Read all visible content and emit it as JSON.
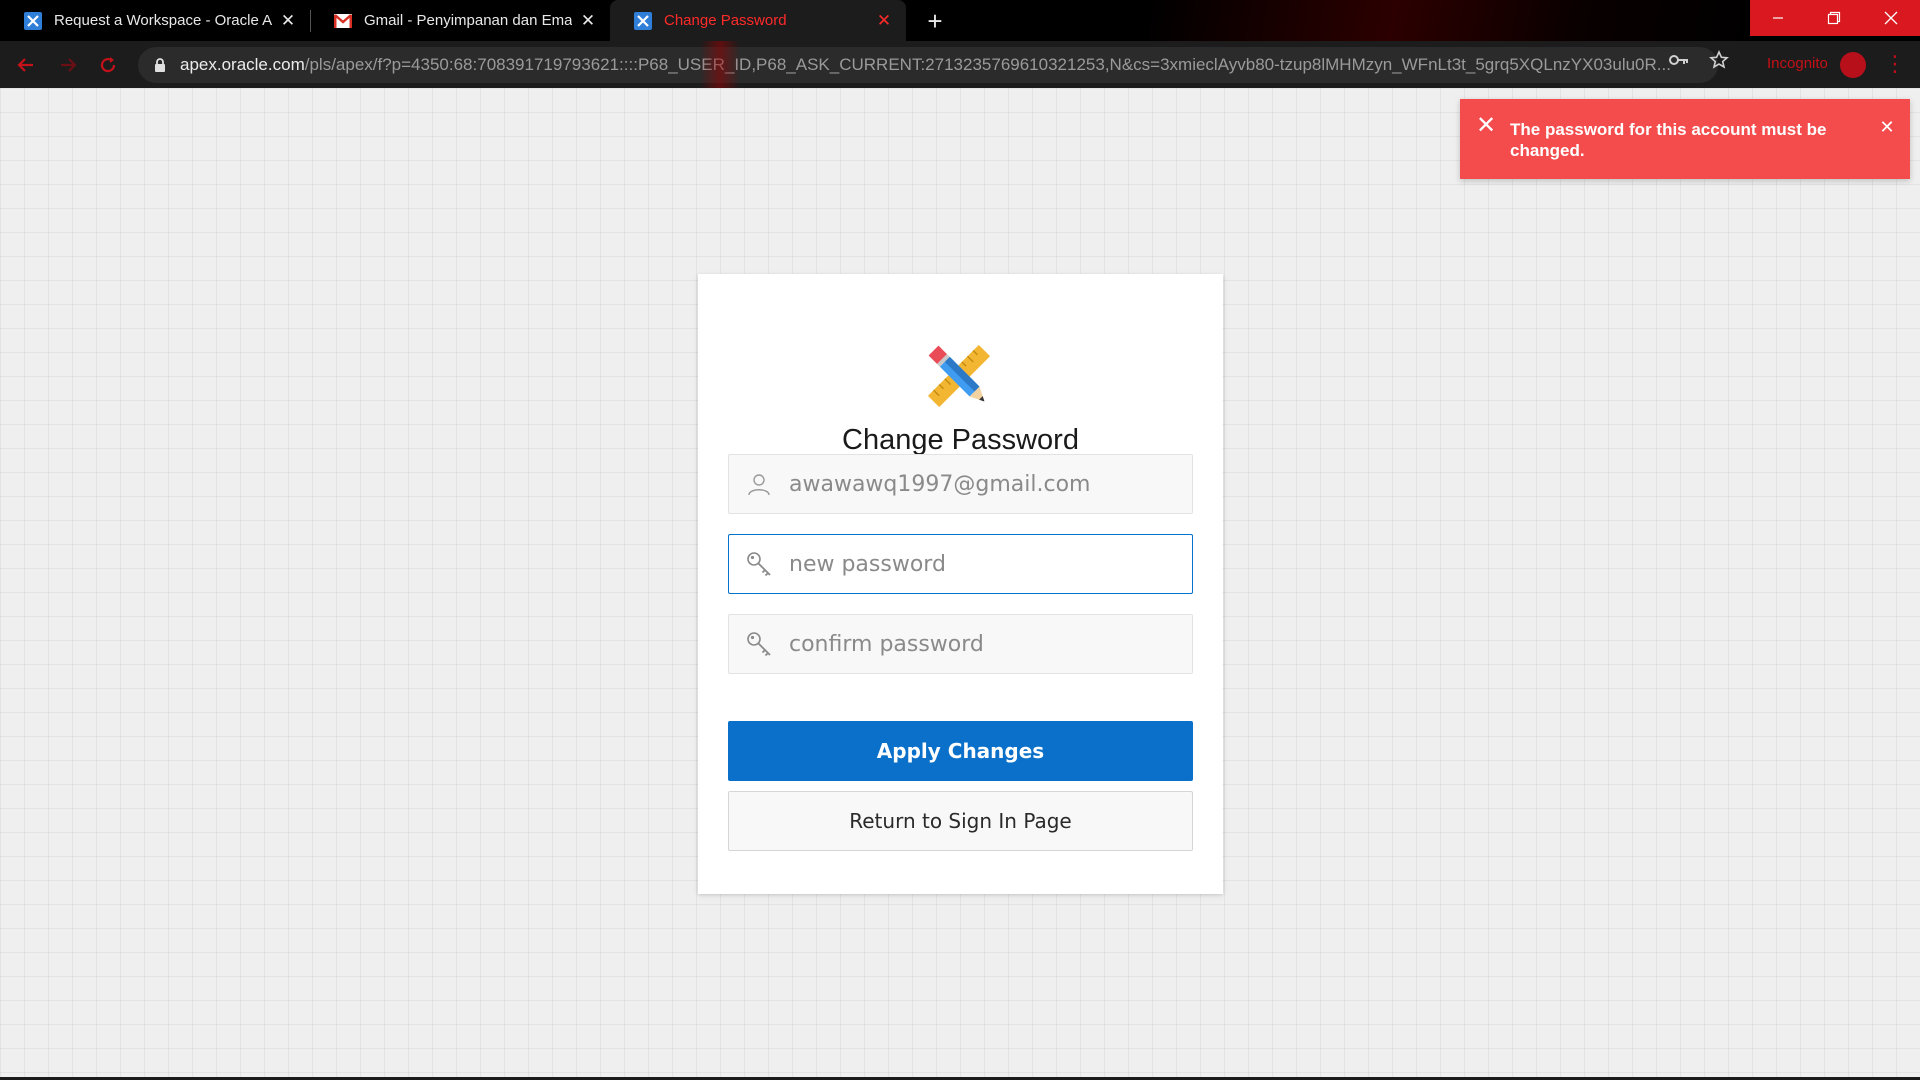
{
  "browser": {
    "tabs": [
      {
        "title": "Request a Workspace - Oracle Ap",
        "favicon": "apex-icon",
        "active": false
      },
      {
        "title": "Gmail - Penyimpanan dan Email G",
        "favicon": "gmail-icon",
        "active": false
      },
      {
        "title": "Change Password",
        "favicon": "apex-icon",
        "active": true
      }
    ],
    "new_tab_label": "+",
    "url": {
      "host": "apex.oracle.com",
      "path": "/pls/apex/f?p=4350:68:708391719793621::::P68_USER_ID,P68_ASK_CURRENT:2713235769610321253,N&cs=3xmieclAyvb80-tzup8lMHMzyn_WFnLt3t_5grq5XQLnzYX03ulu0R..."
    },
    "incognito_label": "Incognito",
    "window_controls": [
      "minimize",
      "restore",
      "close"
    ]
  },
  "alert": {
    "message": "The password for this account must be changed.",
    "color": "#f44b4d"
  },
  "form": {
    "title": "Change Password",
    "username_value": "awawawq1997@gmail.com",
    "new_password_placeholder": "new password",
    "confirm_password_placeholder": "confirm password",
    "apply_button_label": "Apply Changes",
    "return_button_label": "Return to Sign In Page",
    "accent_color": "#0a70c9"
  }
}
